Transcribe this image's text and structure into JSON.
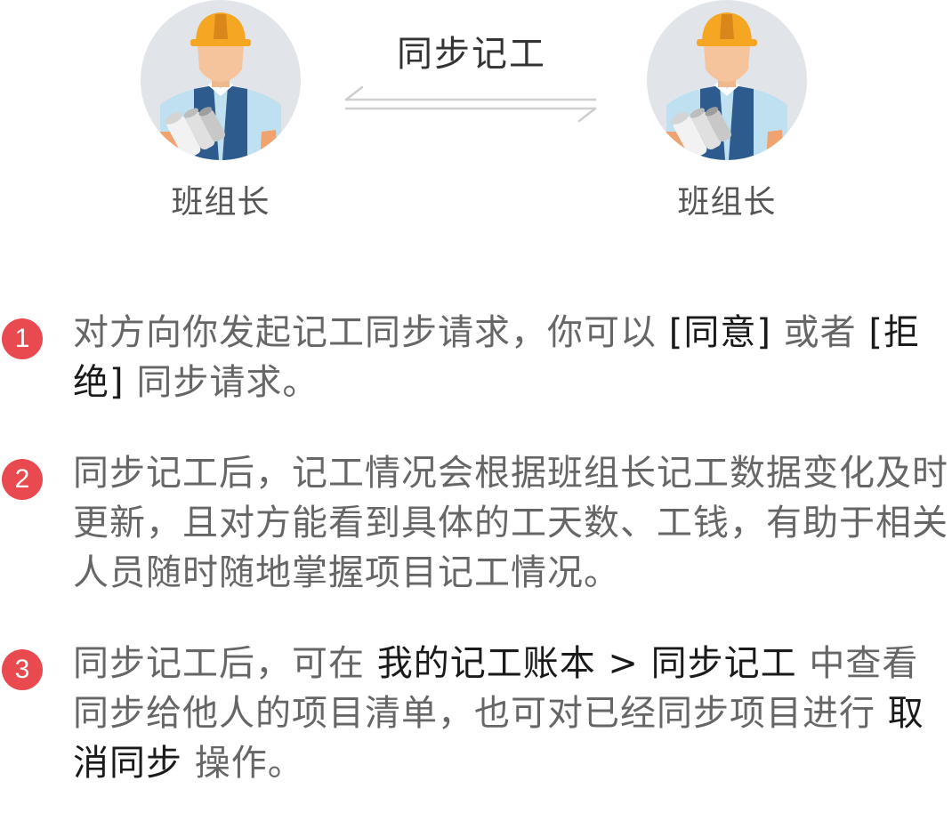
{
  "header": {
    "left_role": "班组长",
    "right_role": "班组长",
    "sync_label": "同步记工",
    "left_avatar_icon": "construction-worker-avatar",
    "right_avatar_icon": "construction-worker-avatar",
    "arrows_icon": "bidirectional-arrows-icon"
  },
  "colors": {
    "badge": "#e84a4f",
    "body_text": "#666666",
    "highlight_text": "#1a1a1a",
    "helmet": "#f5a623",
    "vest": "#2d5b8e",
    "avatar_bg": "#e1e5e9"
  },
  "steps": [
    {
      "number": "1",
      "parts": [
        {
          "text": "对方向你发起记工同步请求，你可以 ",
          "hl": false
        },
        {
          "text": "[同意]",
          "hl": true
        },
        {
          "text": " 或者 ",
          "hl": false
        },
        {
          "text": "[拒绝]",
          "hl": true
        },
        {
          "text": " 同步请求。",
          "hl": false
        }
      ]
    },
    {
      "number": "2",
      "parts": [
        {
          "text": "同步记工后，记工情况会根据班组长记工数据变化及时更新，且对方能看到具体的工天数、工钱，有助于相关人员随时随地掌握项目记工情况。",
          "hl": false
        }
      ]
    },
    {
      "number": "3",
      "parts": [
        {
          "text": "同步记工后，可在 ",
          "hl": false
        },
        {
          "text": "我的记工账本 > 同步记工",
          "hl": true
        },
        {
          "text": " 中查看同步给他人的项目清单，也可对已经同步项目进行 ",
          "hl": false
        },
        {
          "text": "取消同步",
          "hl": true
        },
        {
          "text": " 操作。",
          "hl": false
        }
      ]
    }
  ]
}
